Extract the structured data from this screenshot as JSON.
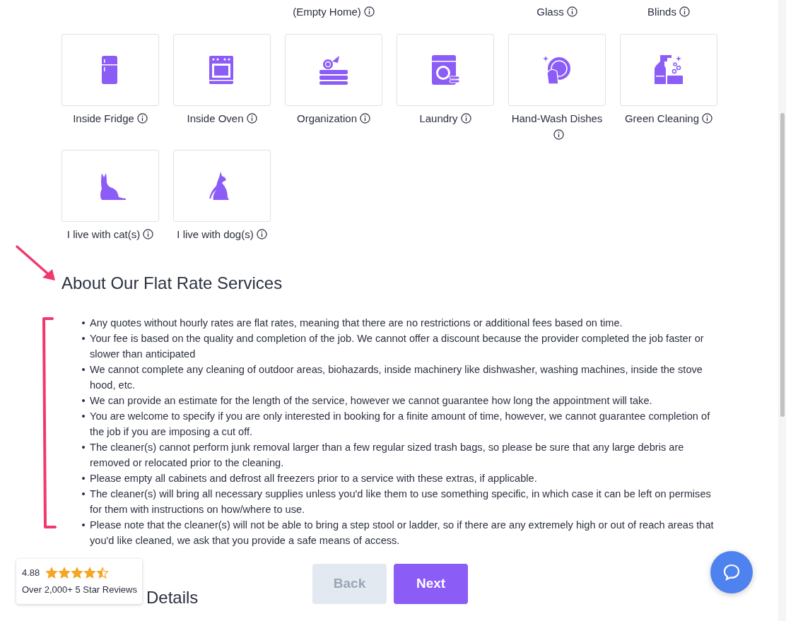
{
  "top_labels": [
    {
      "label": "(Empty Home)"
    },
    {
      "label": "Glass"
    },
    {
      "label": "Blinds"
    }
  ],
  "extras": [
    {
      "label": "Inside Fridge",
      "selected": false
    },
    {
      "label": "Inside Oven",
      "selected": false
    },
    {
      "label": "Organization",
      "selected": false
    },
    {
      "label": "Laundry",
      "selected": false
    },
    {
      "label": "Hand-Wash Dishes",
      "selected": false
    },
    {
      "label": "Green Cleaning",
      "selected": false
    },
    {
      "label": "I live with cat(s)",
      "selected": false
    },
    {
      "label": "I live with dog(s)",
      "selected": false
    }
  ],
  "section": {
    "title": "About Our Flat Rate Services",
    "items": [
      {
        "marker": "•",
        "text": "Any quotes without hourly rates are flat rates, meaning that there are no restrictions or additional fees based on time."
      },
      {
        "marker": "•",
        "text": "Your fee is based on the quality and completion of the job. We cannot offer a discount because the provider completed the job faster or slower than anticipated"
      },
      {
        "marker": "•",
        "text": "We cannot complete any cleaning of outdoor areas, biohazards, inside machinery like dishwasher, washing machines, inside the stove hood, etc."
      },
      {
        "marker": "•",
        "text": "We can provide an estimate for the length of the service, however we cannot guarantee how long the appointment will take."
      },
      {
        "marker": "•",
        "text": "You are welcome to specify if you are only interested in booking for a finite amount of time, however, we cannot guarantee completion of the job if you are imposing a cut off."
      },
      {
        "marker": "•",
        "text": "The cleaner(s) cannot perform junk removal larger than a few regular sized trash bags, so please be sure that any large debris are removed or relocated prior to the cleaning."
      },
      {
        "marker": "•",
        "text": "Please empty all cabinets and defrost all freezers prior to a service with these extras, if applicable."
      },
      {
        "marker": "•",
        "text": "The cleaner(s) will bring all necessary supplies unless you'd like them to use something specific, in which case it can be left on permises for them with instructions on how/where to use."
      },
      {
        "marker": "•",
        "text": "Please note that the cleaner(s) will not be able to bring a step stool or ladder, so if there are any extremely high or out of reach areas that you'd like cleaned, we ask that you provide a safe means of access."
      }
    ]
  },
  "next_heading": "Details",
  "buttons": [
    {
      "label": "Back",
      "disabled": true
    },
    {
      "label": "Next",
      "disabled": false
    }
  ],
  "reviews": {
    "rating": "4.88",
    "stars": 4.5,
    "caption": "Over 2,000+ 5 Star Reviews"
  }
}
